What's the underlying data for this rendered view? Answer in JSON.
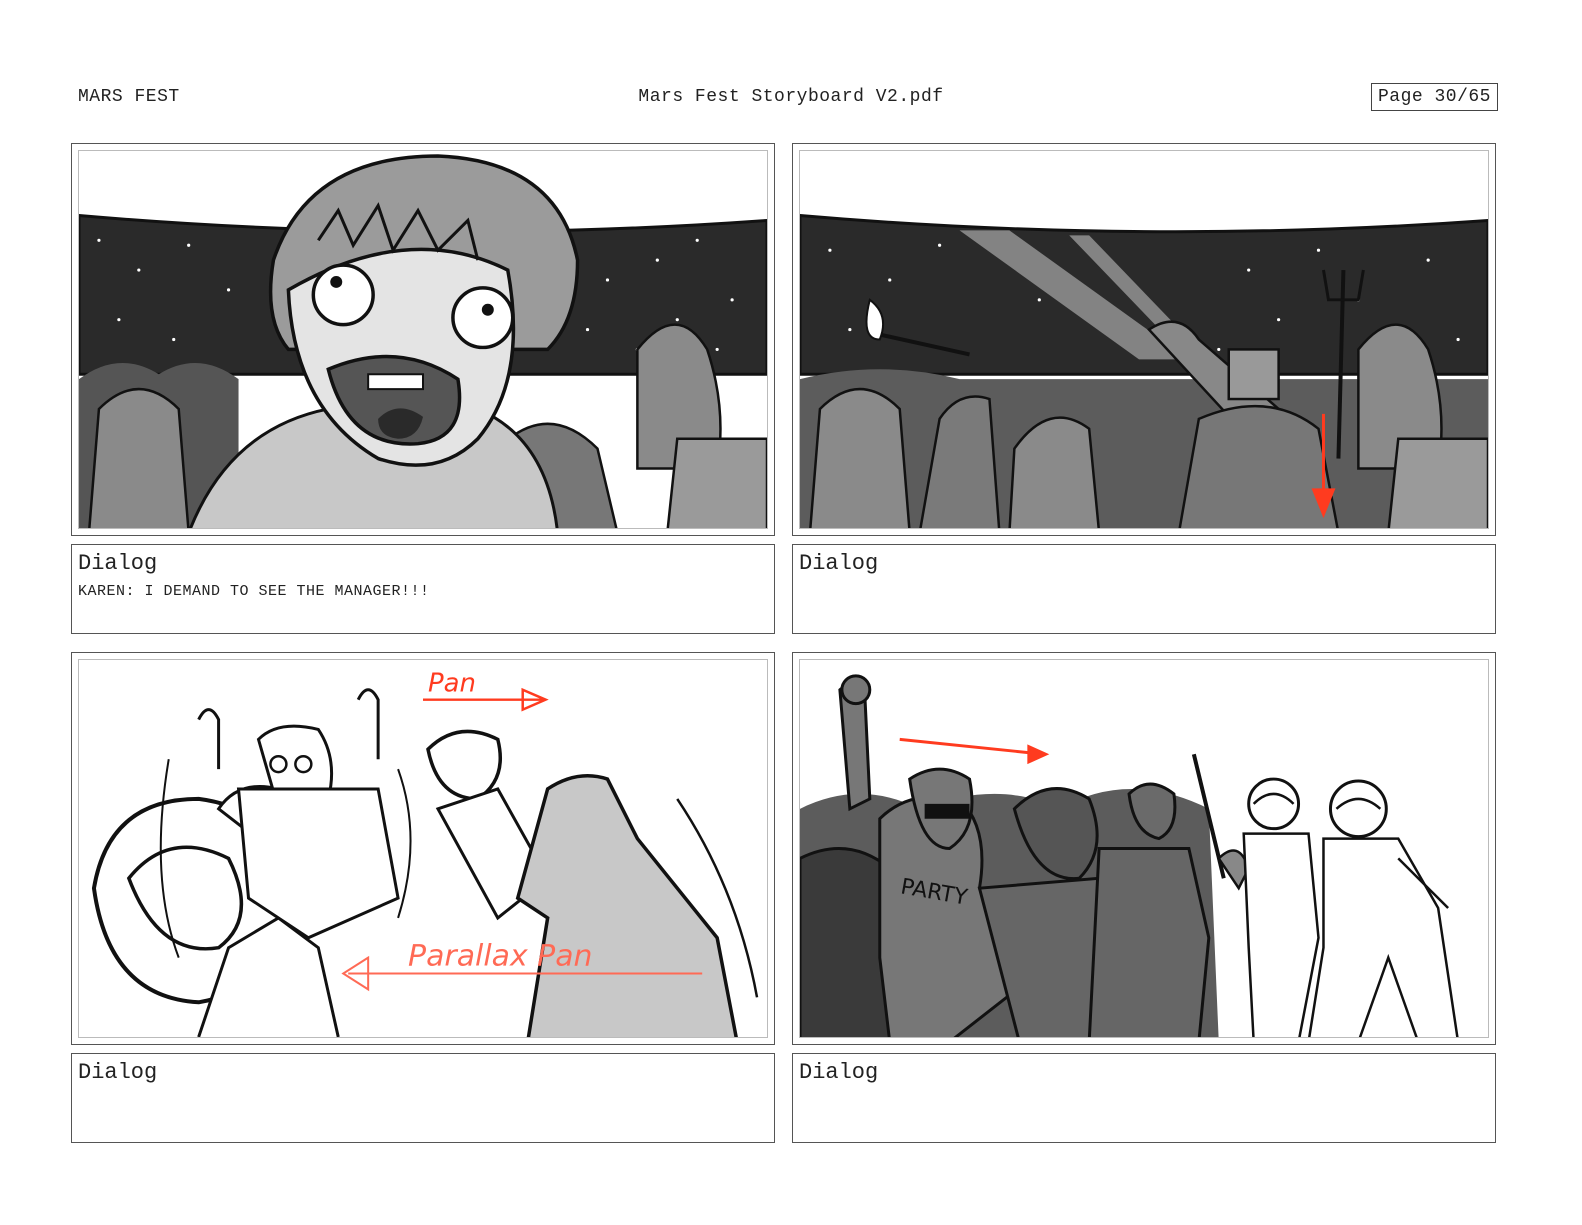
{
  "header": {
    "project": "MARS FEST",
    "file_name": "Mars Fest Storyboard V2.pdf",
    "page": "Page 30/65"
  },
  "panels": [
    {
      "dialog_label": "Dialog",
      "dialog_text": "KAREN: I DEMAND TO SEE THE MANAGER!!!"
    },
    {
      "dialog_label": "Dialog",
      "dialog_text": ""
    },
    {
      "dialog_label": "Dialog",
      "dialog_text": "",
      "annotations": [
        "Pan",
        "Parallax Pan"
      ]
    },
    {
      "dialog_label": "Dialog",
      "dialog_text": "",
      "annotations": [
        "PARTY"
      ]
    }
  ],
  "colors": {
    "annotation": "#ff3b1f",
    "ink": "#111111",
    "sky": "#2a2a2a"
  }
}
